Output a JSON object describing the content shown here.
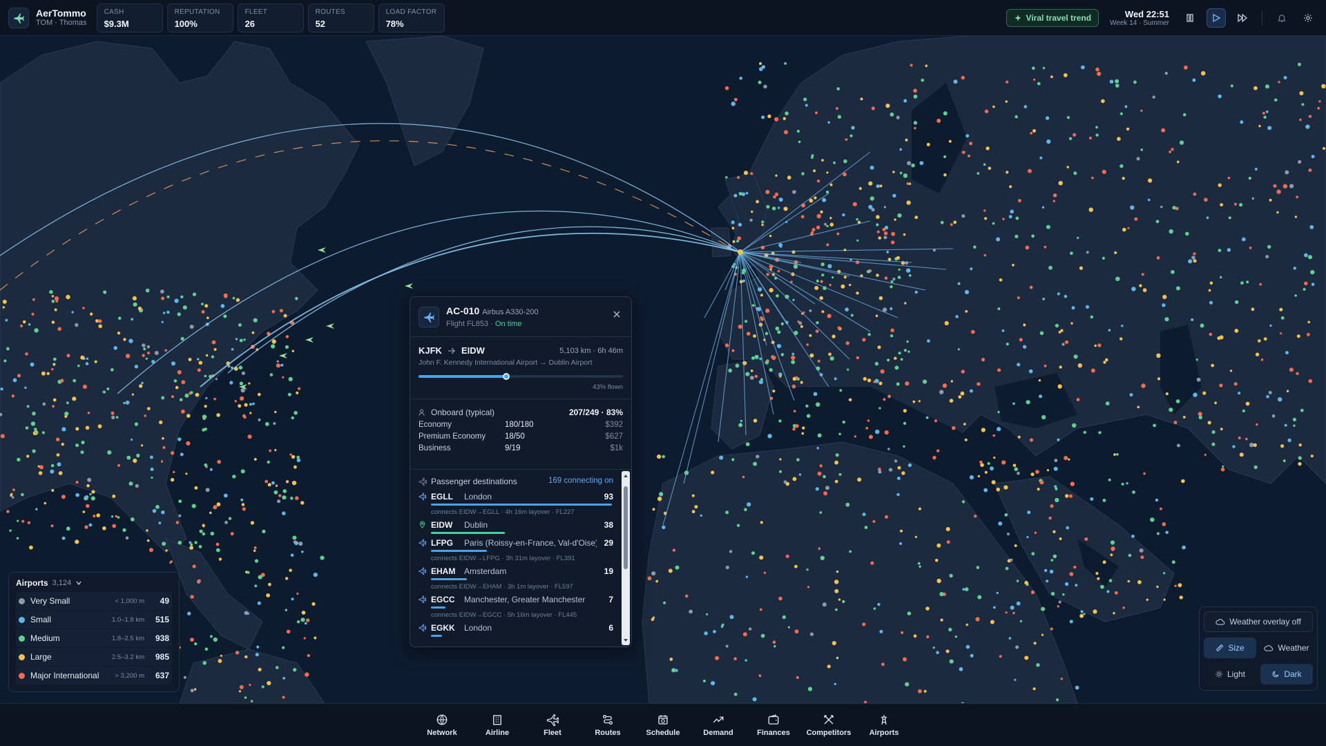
{
  "app": {
    "name": "AerTommo",
    "user": "TOM · Thomas"
  },
  "stats": [
    {
      "label": "CASH",
      "value": "$9.3M"
    },
    {
      "label": "REPUTATION",
      "value": "100%"
    },
    {
      "label": "FLEET",
      "value": "26"
    },
    {
      "label": "ROUTES",
      "value": "52"
    },
    {
      "label": "LOAD FACTOR",
      "value": "78%"
    }
  ],
  "trend": {
    "label": "Viral travel trend"
  },
  "clock": {
    "time": "Wed 22:51",
    "sub": "Week 14 · Summer"
  },
  "flight": {
    "id": "AC-010",
    "aircraft": "Airbus A330-200",
    "flight_prefix": "Flight FL853 · ",
    "status": "On time",
    "origin": "KJFK",
    "destination": "EIDW",
    "distance_time": "5,103 km · 6h 46m",
    "airports": "John F. Kennedy International Airport → Dublin Airport",
    "progress": 0.43,
    "progress_label": "43% flown",
    "onboard_title": "Onboard (typical)",
    "onboard_total": "207/249 · 83%",
    "cabins": [
      {
        "name": "Economy",
        "seats": "180/180",
        "price": "$392"
      },
      {
        "name": "Premium Economy",
        "seats": "18/50",
        "price": "$627"
      },
      {
        "name": "Business",
        "seats": "9/19",
        "price": "$1k"
      }
    ],
    "dest_title": "Passenger destinations",
    "dest_connecting": "169 connecting on",
    "destinations": [
      {
        "code": "EGLL",
        "city": "London",
        "count": "93",
        "share": 1.0,
        "color": "#4aa3e8",
        "conn": "connects EIDW→EGLL · 4h 16m layover · FL227"
      },
      {
        "code": "EIDW",
        "city": "Dublin",
        "count": "38",
        "share": 0.41,
        "color": "#43d39e",
        "conn": ""
      },
      {
        "code": "LFPG",
        "city": "Paris (Roissy-en-France, Val-d'Oise)",
        "count": "29",
        "share": 0.31,
        "color": "#4aa3e8",
        "conn": "connects EIDW→LFPG · 3h 31m layover · FL391"
      },
      {
        "code": "EHAM",
        "city": "Amsterdam",
        "count": "19",
        "share": 0.2,
        "color": "#4aa3e8",
        "conn": "connects EIDW→EHAM · 3h 1m layover · FL597"
      },
      {
        "code": "EGCC",
        "city": "Manchester, Greater Manchester",
        "count": "7",
        "share": 0.08,
        "color": "#4aa3e8",
        "conn": "connects EIDW→EGCC · 5h 16m layover · FL445"
      },
      {
        "code": "EGKK",
        "city": "London",
        "count": "6",
        "share": 0.06,
        "color": "#4aa3e8",
        "conn": ""
      }
    ]
  },
  "legend": {
    "title": "Airports",
    "count": "3,124",
    "rows": [
      {
        "name": "Very Small",
        "range": "< 1,000 m",
        "count": "49",
        "color": "#8f98a8"
      },
      {
        "name": "Small",
        "range": "1.0–1.8 km",
        "count": "515",
        "color": "#5fb6e8"
      },
      {
        "name": "Medium",
        "range": "1.8–2.5 km",
        "count": "938",
        "color": "#5fd08e"
      },
      {
        "name": "Large",
        "range": "2.5–3.2 km",
        "count": "985",
        "color": "#f2c14e"
      },
      {
        "name": "Major International",
        "range": "> 3,200 m",
        "count": "637",
        "color": "#f26b4f"
      }
    ]
  },
  "map_controls": {
    "weather_overlay": "Weather overlay off",
    "size": "Size",
    "weather": "Weather",
    "light": "Light",
    "dark": "Dark"
  },
  "nav": [
    {
      "label": "Network",
      "icon": "network-icon"
    },
    {
      "label": "Airline",
      "icon": "airline-icon"
    },
    {
      "label": "Fleet",
      "icon": "fleet-icon"
    },
    {
      "label": "Routes",
      "icon": "routes-icon"
    },
    {
      "label": "Schedule",
      "icon": "schedule-icon"
    },
    {
      "label": "Demand",
      "icon": "demand-icon"
    },
    {
      "label": "Finances",
      "icon": "finances-icon"
    },
    {
      "label": "Competitors",
      "icon": "competitors-icon"
    },
    {
      "label": "Airports",
      "icon": "airports-icon"
    }
  ]
}
